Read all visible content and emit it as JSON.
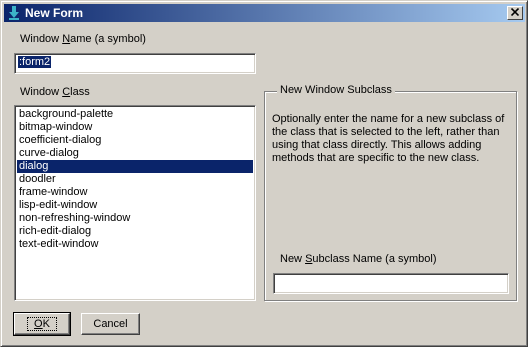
{
  "window": {
    "title": "New Form",
    "icon": "lisp-form-icon",
    "close_glyph": "✕"
  },
  "name_field": {
    "label_pre": "Window ",
    "label_ul": "N",
    "label_post": "ame (a symbol)",
    "value": ":form2"
  },
  "class_list": {
    "label_pre": "Window ",
    "label_ul": "C",
    "label_post": "lass",
    "items": [
      "background-palette",
      "bitmap-window",
      "coefficient-dialog",
      "curve-dialog",
      "dialog",
      "doodler",
      "frame-window",
      "lisp-edit-window",
      "non-refreshing-window",
      "rich-edit-dialog",
      "text-edit-window"
    ],
    "selected_index": 4
  },
  "subclass_group": {
    "title": "New Window Subclass",
    "description": "Optionally enter the name for a new subclass of the class that is selected to the left, rather than using that class directly.  This allows adding methods that are specific to the new class.",
    "field_label_pre": "New ",
    "field_label_ul": "S",
    "field_label_post": "ubclass Name (a symbol)",
    "field_value": ""
  },
  "buttons": {
    "ok_ul": "O",
    "ok_post": "K",
    "cancel": "Cancel"
  },
  "colors": {
    "title_start": "#0a246a",
    "title_end": "#a6caf0",
    "face": "#d4d0c8",
    "selection": "#0a246a"
  }
}
